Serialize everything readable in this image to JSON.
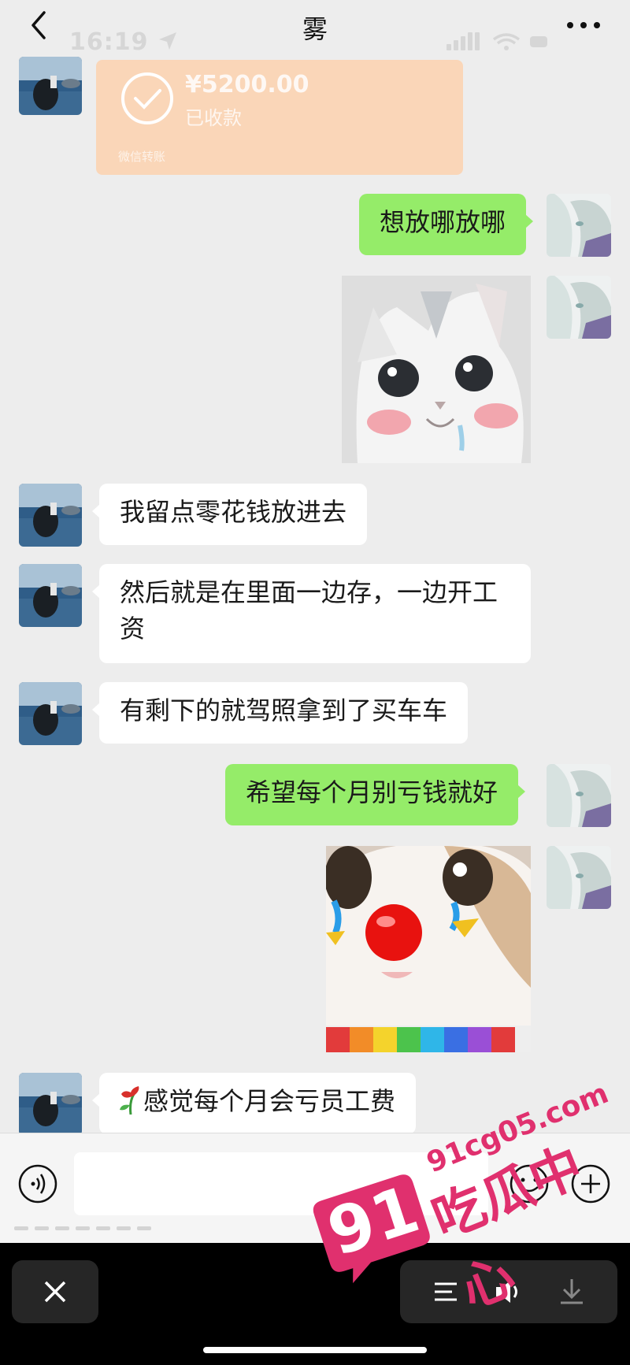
{
  "header": {
    "title": "雾",
    "time": "16:19"
  },
  "transfer": {
    "amount": "¥5200.00",
    "status": "已收款",
    "footer": "微信转账"
  },
  "messages": [
    {
      "side": "out",
      "text": "想放哪放哪"
    },
    {
      "side": "in",
      "text": "我留点零花钱放进去"
    },
    {
      "side": "in",
      "text": "然后就是在里面一边存，一边开工资"
    },
    {
      "side": "in",
      "text": "有剩下的就驾照拿到了买车车"
    },
    {
      "side": "out",
      "text": "希望每个月别亏钱就好"
    },
    {
      "side": "in",
      "text": "感觉每个月会亏员工费",
      "emoji": "wilted-flower"
    }
  ],
  "watermark": {
    "badge": "91",
    "url": "91cg05.com",
    "brand": "吃瓜中心"
  },
  "colors": {
    "background": "#ededed",
    "outgoing_bubble": "#95ec69",
    "incoming_bubble": "#ffffff",
    "watermark": "#e0306e",
    "transfer_card": "#fad6b8"
  },
  "icons": [
    "back-arrow-icon",
    "more-icon",
    "location-icon",
    "signal-icon",
    "wifi-icon",
    "battery-icon",
    "check-circle-icon",
    "voice-icon",
    "emoji-icon",
    "plus-icon",
    "close-icon",
    "list-icon",
    "speaker-icon",
    "download-icon"
  ]
}
